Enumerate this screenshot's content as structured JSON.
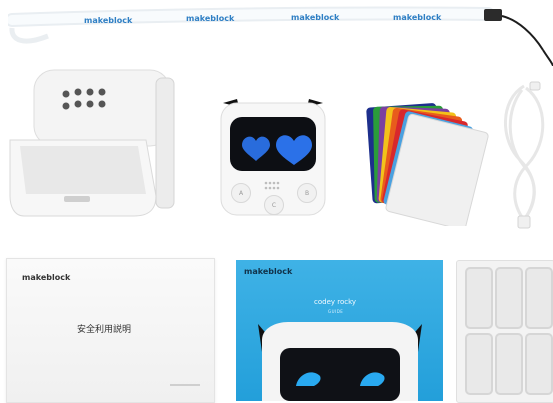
{
  "lanyard": {
    "print": [
      "makeblock",
      "makeblock",
      "makeblock",
      "makeblock"
    ]
  },
  "codey": {
    "buttons": [
      "A",
      "C",
      "B"
    ],
    "face_color": "#0d0f14",
    "eye_color": "#2f7cff"
  },
  "safety_booklet": {
    "brand": "makeblock",
    "title": "安全利用説明"
  },
  "guide_booklet": {
    "brand": "makeblock",
    "title": "codey rocky",
    "subtitle": "GUIDE"
  },
  "cards": {
    "colors": [
      "#1d2f8c",
      "#2a9d3a",
      "#7b3fa0",
      "#f2c21b",
      "#e85c1c",
      "#d8282d",
      "#4aa1e0",
      "#f0f0f0"
    ]
  }
}
